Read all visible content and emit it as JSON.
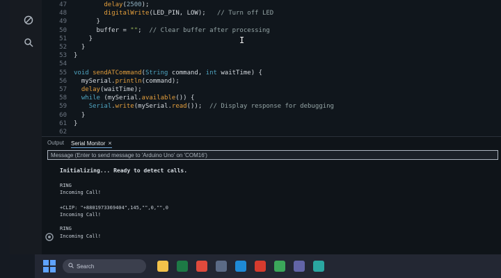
{
  "editor": {
    "lines": [
      {
        "num": "47",
        "segments": [
          {
            "t": "        ",
            "c": "plain"
          },
          {
            "t": "delay",
            "c": "fn"
          },
          {
            "t": "(",
            "c": "plain"
          },
          {
            "t": "2500",
            "c": "num"
          },
          {
            "t": ");",
            "c": "plain"
          }
        ]
      },
      {
        "num": "48",
        "segments": [
          {
            "t": "        ",
            "c": "plain"
          },
          {
            "t": "digitalWrite",
            "c": "fn"
          },
          {
            "t": "(LED_PIN, LOW);   ",
            "c": "plain"
          },
          {
            "t": "// Turn off LED",
            "c": "cm"
          }
        ]
      },
      {
        "num": "49",
        "segments": [
          {
            "t": "      }",
            "c": "plain"
          }
        ]
      },
      {
        "num": "50",
        "segments": [
          {
            "t": "      buffer = ",
            "c": "plain"
          },
          {
            "t": "\"\"",
            "c": "str"
          },
          {
            "t": ";  ",
            "c": "plain"
          },
          {
            "t": "// Clear buffer after processing",
            "c": "cm"
          }
        ]
      },
      {
        "num": "51",
        "segments": [
          {
            "t": "    }",
            "c": "plain"
          }
        ]
      },
      {
        "num": "52",
        "segments": [
          {
            "t": "  }",
            "c": "plain"
          }
        ]
      },
      {
        "num": "53",
        "segments": [
          {
            "t": "}",
            "c": "plain"
          }
        ]
      },
      {
        "num": "54",
        "segments": []
      },
      {
        "num": "55",
        "segments": [
          {
            "t": "void ",
            "c": "kw"
          },
          {
            "t": "sendATCommand",
            "c": "fn"
          },
          {
            "t": "(",
            "c": "plain"
          },
          {
            "t": "String",
            "c": "kw"
          },
          {
            "t": " command, ",
            "c": "plain"
          },
          {
            "t": "int",
            "c": "kw"
          },
          {
            "t": " waitTime) {",
            "c": "plain"
          }
        ]
      },
      {
        "num": "56",
        "segments": [
          {
            "t": "  mySerial.",
            "c": "plain"
          },
          {
            "t": "println",
            "c": "fn"
          },
          {
            "t": "(command);",
            "c": "plain"
          }
        ]
      },
      {
        "num": "57",
        "segments": [
          {
            "t": "  ",
            "c": "plain"
          },
          {
            "t": "delay",
            "c": "fn"
          },
          {
            "t": "(waitTime);",
            "c": "plain"
          }
        ]
      },
      {
        "num": "58",
        "segments": [
          {
            "t": "  ",
            "c": "plain"
          },
          {
            "t": "while",
            "c": "kw"
          },
          {
            "t": " (mySerial.",
            "c": "plain"
          },
          {
            "t": "available",
            "c": "fn"
          },
          {
            "t": "()) {",
            "c": "plain"
          }
        ]
      },
      {
        "num": "59",
        "segments": [
          {
            "t": "    ",
            "c": "plain"
          },
          {
            "t": "Serial",
            "c": "kw"
          },
          {
            "t": ".",
            "c": "plain"
          },
          {
            "t": "write",
            "c": "fn"
          },
          {
            "t": "(mySerial.",
            "c": "plain"
          },
          {
            "t": "read",
            "c": "fn"
          },
          {
            "t": "());  ",
            "c": "plain"
          },
          {
            "t": "// Display response for debugging",
            "c": "cm"
          }
        ]
      },
      {
        "num": "60",
        "segments": [
          {
            "t": "  }",
            "c": "plain"
          }
        ]
      },
      {
        "num": "61",
        "segments": [
          {
            "t": "}",
            "c": "plain"
          }
        ]
      },
      {
        "num": "62",
        "segments": []
      }
    ]
  },
  "panel": {
    "tab_output": "Output",
    "tab_serial": "Serial Monitor",
    "tab_close": "×",
    "message_placeholder": "Message (Enter to send message to 'Arduino Uno' on 'COM16')",
    "output": [
      {
        "text": "Initializing... Ready to detect calls.",
        "bold": true
      },
      {
        "text": "RING",
        "bold": false
      },
      {
        "text": "Incoming Call!",
        "bold": false
      },
      {
        "text": "+CLIP: \"+8801973369404\",145,\"\",0,\"\",0",
        "bold": false
      },
      {
        "text": "Incoming Call!",
        "bold": false
      },
      {
        "text": "RING",
        "bold": false
      },
      {
        "text": "Incoming Call!",
        "bold": false
      }
    ]
  },
  "taskbar": {
    "search_label": "Search",
    "apps": [
      "file-explorer",
      "excel",
      "chrome",
      "news",
      "vscode",
      "acrobat",
      "chrome-alt",
      "teams",
      "arduino"
    ]
  },
  "colors": {
    "keyword": "#4fa4c0",
    "function": "#e39e3c",
    "string": "#a5c25c",
    "comment": "#95a5a6"
  }
}
